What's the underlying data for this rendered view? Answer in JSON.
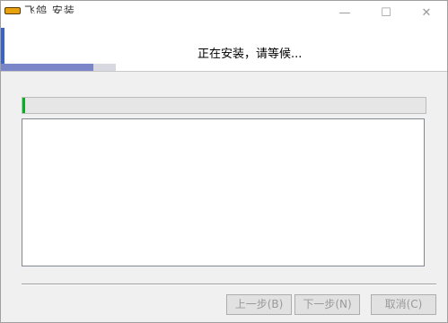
{
  "window": {
    "title": "飞鸽 安装",
    "minimize_glyph": "—",
    "maximize_glyph": "☐",
    "close_glyph": "✕"
  },
  "header": {
    "title": "正在安装，请等候..."
  },
  "progress": {
    "value": 0.005,
    "color": "#06b025"
  },
  "log": {
    "lines": []
  },
  "buttons": {
    "back_label": "上一步(B)",
    "next_label": "下一步(N)",
    "cancel_label": "取消(C)"
  }
}
